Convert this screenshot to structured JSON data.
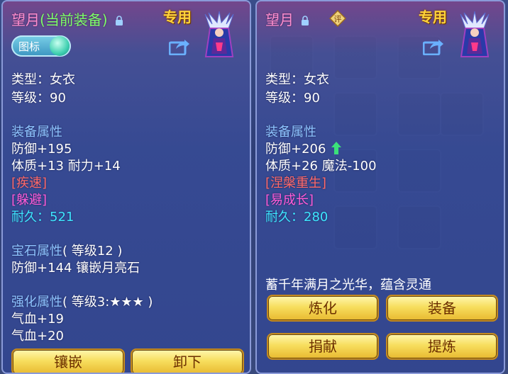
{
  "left_panel": {
    "item_name": "望月",
    "equipped_tag": "(当前装备)",
    "badge": "专用",
    "toggle_label": "图标",
    "type_line": "类型：女衣",
    "level_line": "等级：90",
    "equip_attr_header": "装备属性",
    "defense": "防御+195",
    "stats": "体质+13 耐力+14",
    "special_skill": "[疾速]",
    "special_effect": "[躲避]",
    "durability": "耐久：521",
    "gem_header": "宝石属性",
    "gem_level": "( 等级12 )",
    "gem_stat": "防御+144 镶嵌月亮石",
    "enhance_header": "强化属性",
    "enhance_level": "( 等级3:★★★ )",
    "enhance_stat_1": "气血+19",
    "enhance_stat_2": "气血+20",
    "buttons": {
      "inlay": "镶嵌",
      "unequip": "卸下"
    }
  },
  "right_panel": {
    "item_name": "望月",
    "badge": "专用",
    "evaluate_icon_text": "评",
    "type_line": "类型：女衣",
    "level_line": "等级：90",
    "equip_attr_header": "装备属性",
    "defense": "防御+206",
    "stats": "体质+26 魔法-100",
    "special_skill": "[涅槃重生]",
    "special_effect": "[易成长]",
    "durability": "耐久：280",
    "description": "蓄千年满月之光华，蕴含灵通",
    "buttons": {
      "refine": "炼化",
      "equip": "装备",
      "donate": "捐献",
      "extract": "提炼"
    }
  },
  "colors": {
    "title": "#ff8fd0",
    "equipped": "#7dff6a",
    "section": "#8ec4ff",
    "special_skill": "#ff6a6a",
    "special_effect": "#ff5cd8",
    "durability": "#3ee6ff",
    "up_arrow": "#3be07a"
  }
}
